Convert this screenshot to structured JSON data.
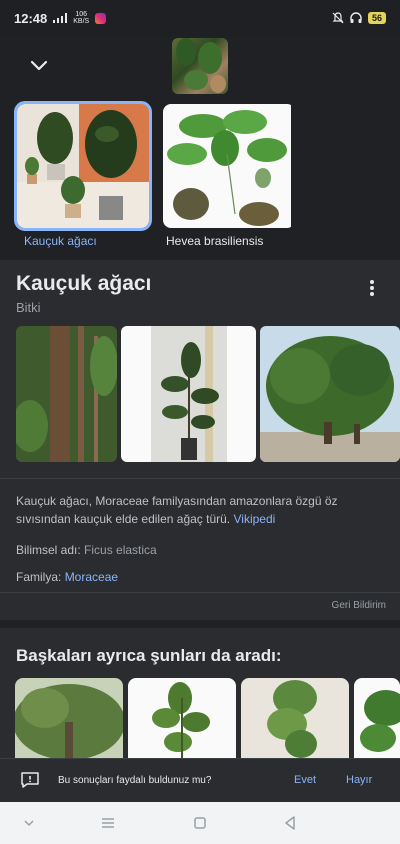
{
  "status": {
    "time": "12:48",
    "netspeed_value": "106",
    "netspeed_unit": "KB/S",
    "battery": "56"
  },
  "tiles": [
    {
      "label": "Kauçuk ağacı",
      "selected": true
    },
    {
      "label": "Hevea brasiliensis",
      "selected": false
    }
  ],
  "knowledge_panel": {
    "title": "Kauçuk ağacı",
    "subtitle": "Bitki",
    "description": "Kauçuk ağacı, Moraceae familyasından amazonlara özgü öz sıvısından kauçuk elde edilen ağaç türü.",
    "source_link": "Vikipedi",
    "scientific_name_label": "Bilimsel adı:",
    "scientific_name_value": "Ficus elastica",
    "family_label": "Familya:",
    "family_value": "Moraceae",
    "feedback_link": "Geri Bildirim"
  },
  "also_searched": {
    "title": "Başkaları ayrıca şunları da aradı:"
  },
  "feedback_bar": {
    "question": "Bu sonuçları faydalı buldunuz mu?",
    "yes": "Evet",
    "no": "Hayır"
  },
  "colors": {
    "accent": "#8ab4f8",
    "background": "#202124",
    "card": "#2b2c2f"
  }
}
